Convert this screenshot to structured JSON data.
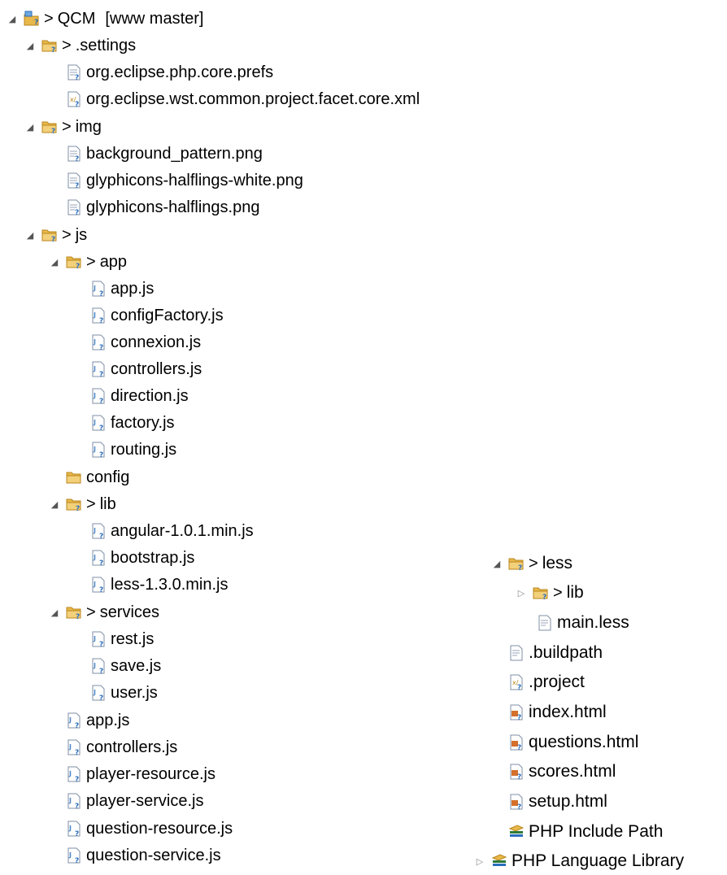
{
  "tree": {
    "project": {
      "name": "QCM",
      "branch": "[www master]",
      "prefix": ">"
    },
    "settings": {
      "name": ".settings",
      "prefix": ">"
    },
    "settings_files": [
      "org.eclipse.php.core.prefs",
      "org.eclipse.wst.common.project.facet.core.xml"
    ],
    "img": {
      "name": "img",
      "prefix": ">"
    },
    "img_files": [
      "background_pattern.png",
      "glyphicons-halflings-white.png",
      "glyphicons-halflings.png"
    ],
    "js": {
      "name": "js",
      "prefix": ">"
    },
    "app": {
      "name": "app",
      "prefix": ">"
    },
    "app_files": [
      "app.js",
      "configFactory.js",
      "connexion.js",
      "controllers.js",
      "direction.js",
      "factory.js",
      "routing.js"
    ],
    "config": {
      "name": "config"
    },
    "lib": {
      "name": "lib",
      "prefix": ">"
    },
    "lib_files": [
      "angular-1.0.1.min.js",
      "bootstrap.js",
      "less-1.3.0.min.js"
    ],
    "services": {
      "name": "services",
      "prefix": ">"
    },
    "services_files": [
      "rest.js",
      "save.js",
      "user.js"
    ],
    "js_files": [
      "app.js",
      "controllers.js",
      "player-resource.js",
      "player-service.js",
      "question-resource.js",
      "question-service.js"
    ],
    "less": {
      "name": "less",
      "prefix": ">"
    },
    "less_lib": {
      "name": "lib",
      "prefix": ">"
    },
    "less_files": [
      "main.less"
    ],
    "root_files": [
      ".buildpath",
      ".project",
      "index.html",
      "questions.html",
      "scores.html",
      "setup.html"
    ],
    "libraries": [
      "PHP Include Path",
      "PHP Language Library"
    ]
  },
  "twisty": {
    "expanded": "◢",
    "collapsed": "▷"
  },
  "icons": {
    "folder": "folder-icon",
    "project": "php-project-icon",
    "file": "text-file-icon",
    "xml": "xml-file-icon",
    "js": "js-file-icon",
    "html": "html-file-icon",
    "library": "library-icon"
  },
  "colors": {
    "folder": "#e8b84a",
    "folder_dark": "#b8861c",
    "file_bg": "#ffffff",
    "file_border": "#7f8fa6",
    "badge": "#2a6ebd",
    "js": "#4e88c7",
    "html": "#d4702c",
    "library": "#2d7a3a"
  }
}
